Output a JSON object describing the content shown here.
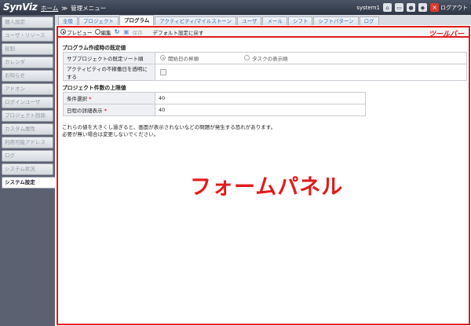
{
  "app": {
    "logo": "SynViz"
  },
  "breadcrumb": {
    "home": "ホーム",
    "separator": "≫",
    "current": "管理メニュー"
  },
  "topbar": {
    "user": "system1",
    "logout_label": "ログアウト"
  },
  "sidebar": {
    "items": [
      {
        "label": "個人設定",
        "active": false
      },
      {
        "label": "ユーザ・リソース",
        "active": false
      },
      {
        "label": "役割",
        "active": false
      },
      {
        "label": "カレンダ",
        "active": false
      },
      {
        "label": "お知らせ",
        "active": false
      },
      {
        "label": "アドオン",
        "active": false
      },
      {
        "label": "ログインユーザ",
        "active": false
      },
      {
        "label": "プロジェクト削除",
        "active": false
      },
      {
        "label": "カスタム属性",
        "active": false
      },
      {
        "label": "利用可能アドレス",
        "active": false
      },
      {
        "label": "ログ",
        "active": false
      },
      {
        "label": "システム状況",
        "active": false
      },
      {
        "label": "システム設定",
        "active": true
      }
    ]
  },
  "tabs": [
    {
      "label": "全般",
      "active": false
    },
    {
      "label": "プロジェクト",
      "active": false
    },
    {
      "label": "プログラム",
      "active": true
    },
    {
      "label": "アクティビティ/マイルストーン",
      "active": false
    },
    {
      "label": "ユーザ",
      "active": false
    },
    {
      "label": "メール",
      "active": false
    },
    {
      "label": "シフト",
      "active": false
    },
    {
      "label": "シフトパターン",
      "active": false
    },
    {
      "label": "ログ",
      "active": false
    }
  ],
  "toolbar": {
    "preview_label": "プレビュー",
    "edit_label": "編集",
    "save_label": "保存",
    "reset_label": "デフォルト設定に戻す",
    "annotation": "ツールバー"
  },
  "form": {
    "section1": {
      "title": "プログラム作成時の既定値",
      "sort_label": "サブプロジェクトの既定ソート順",
      "sort_option1": "開始日の昇順",
      "sort_option2": "タスクの表示順",
      "transparent_label": "アクティビティの不稼働日を透明にする"
    },
    "section2": {
      "title": "プロジェクト件数の上限値",
      "condition_label": "条件選択",
      "condition_value": "40",
      "schedule_label": "日程の詳細表示",
      "schedule_value": "40"
    },
    "required_mark": "*",
    "note_line1": "これらの値を大きくし過ぎると、画面が表示されないなどの問題が発生する恐れがあります。",
    "note_line2": "必要が無い場合は変更しないでください。",
    "annotation": "フォームパネル"
  },
  "colors": {
    "highlight": "#e21b1b",
    "sidebar_bg": "#5b6170",
    "topbar_bg": "#2e3644",
    "link": "#3a6fb0"
  }
}
